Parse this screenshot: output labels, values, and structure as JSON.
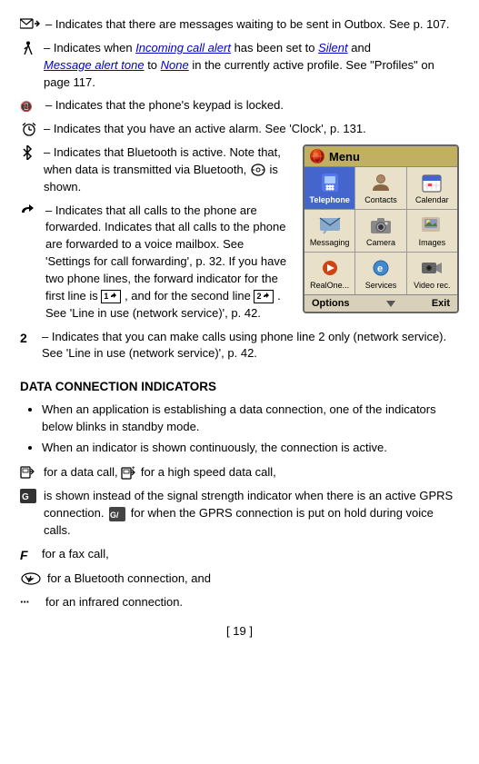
{
  "page": {
    "number": "[ 19 ]"
  },
  "indicators": {
    "outbox_text": "– Indicates that there are messages waiting to be sent in Outbox. See p. 107.",
    "silent_text_prefix": "– Indicates when ",
    "incoming_call_alert": "Incoming call alert",
    "has_been_set_to": " has been set to ",
    "silent": "Silent",
    "and": " and",
    "message_alert_tone": "Message alert tone",
    "to_none": " to ",
    "none": "None",
    "in_active_profile": " in the currently active profile.   See \"Profiles\" on page 117.",
    "keypad_locked_text": "– Indicates that the phone's keypad is locked.",
    "alarm_text": "– Indicates that you have an active alarm. See 'Clock', p. 131.",
    "bluetooth_text": "– Indicates that Bluetooth is active. Note that, when data is transmitted via Bluetooth,",
    "bluetooth_shown": "is shown.",
    "forward_text": "– Indicates that all calls to the phone are forwarded.  Indicates that all calls to the phone are forwarded to a voice mailbox.  See 'Settings for call forwarding', p. 32. If you have two phone lines, the forward indicator for the first line is",
    "forward_and": ", and for the second line",
    "forward_see": ". See 'Line in use (network service)', p. 42.",
    "line2_text": "– Indicates that you can make calls using phone line 2 only (network service). See 'Line in use (network service)', p. 42.",
    "data_section_heading": "DATA CONNECTION INDICATORS",
    "bullet1": "When an application is establishing a data connection, one of the indicators below blinks in standby mode.",
    "bullet2": "When an indicator is shown continuously, the connection is active.",
    "data_call_text": " for a data call, ",
    "high_speed_text": " for a high speed data call,",
    "gprs_text": " is shown instead of the signal strength indicator when there is an active GPRS connection. ",
    "gprs_hold_text": " for when the GPRS connection is put on hold during voice calls.",
    "fax_text": " for a fax call,",
    "bluetooth_conn_text": " for a Bluetooth connection, and",
    "infrared_text": " for an infrared connection."
  },
  "menu": {
    "title": "Menu",
    "items": [
      {
        "label": "Telephone",
        "icon": "phone"
      },
      {
        "label": "Contacts",
        "icon": "contacts"
      },
      {
        "label": "Calendar",
        "icon": "calendar"
      },
      {
        "label": "Messaging",
        "icon": "messaging"
      },
      {
        "label": "Camera",
        "icon": "camera"
      },
      {
        "label": "Images",
        "icon": "images"
      },
      {
        "label": "RealOne...",
        "icon": "realone"
      },
      {
        "label": "Services",
        "icon": "services"
      },
      {
        "label": "Video rec.",
        "icon": "videorec"
      }
    ],
    "softkey_left": "Options",
    "softkey_right": "Exit"
  }
}
